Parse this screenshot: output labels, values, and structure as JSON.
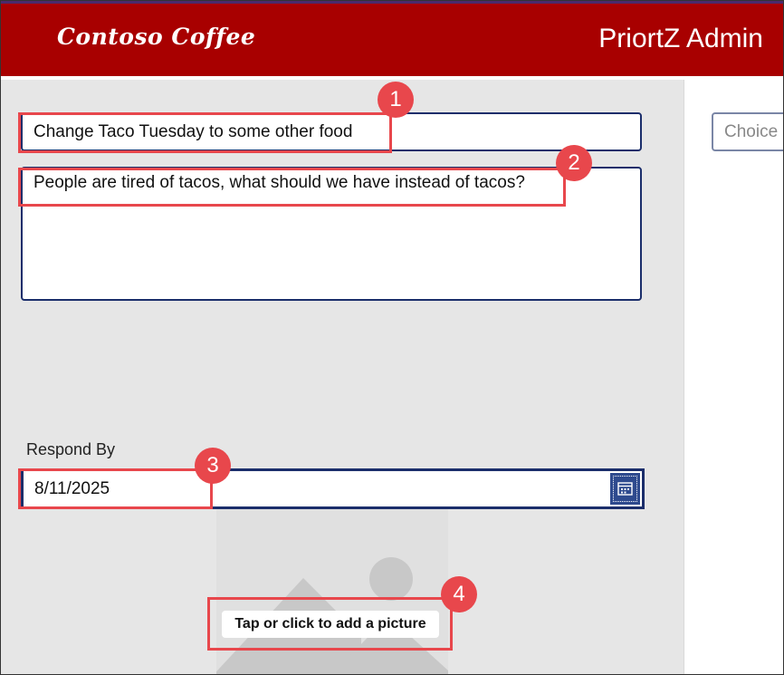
{
  "header": {
    "brand": "Contoso Coffee",
    "app_title": "PriortZ Admin",
    "background": "#a80000"
  },
  "form": {
    "title_value": "Change Taco Tuesday to some other food",
    "description_value": "People are tired of tacos, what should we have instead of tacos?",
    "choice_placeholder": "Choice",
    "respond_by_label": "Respond By",
    "respond_by_value": "8/11/2025",
    "picture_prompt": "Tap or click to add a picture"
  },
  "callouts": [
    "1",
    "2",
    "3",
    "4"
  ],
  "colors": {
    "accent": "#1b2e6b",
    "callout": "#e8474c",
    "panel": "#e6e6e6"
  }
}
